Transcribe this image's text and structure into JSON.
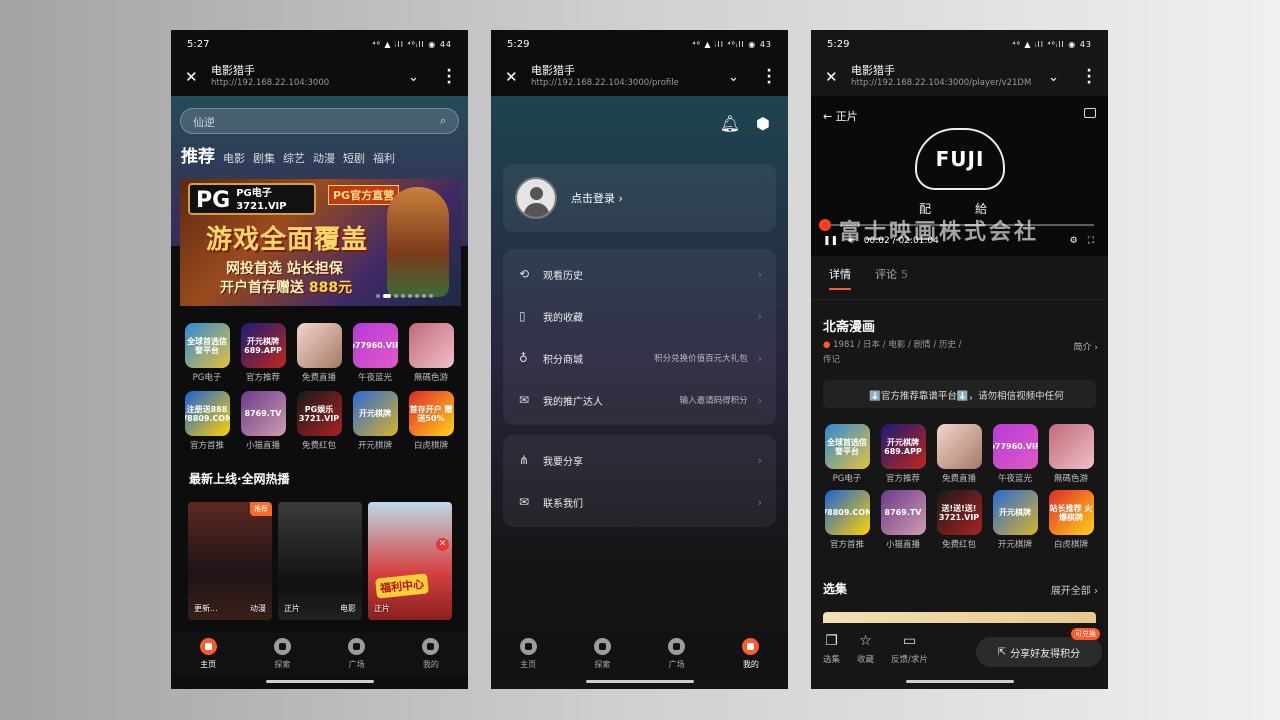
{
  "app": {
    "name": "电影猎手"
  },
  "phones": [
    {
      "time": "5:27",
      "status": "⁴⁶ ▲ ᵢll ⁴⁶ᵢll ◉ 44",
      "url": "http://192.168.22.104:3000",
      "search": {
        "placeholder": "仙逆"
      },
      "categories": [
        "推荐",
        "电影",
        "剧集",
        "综艺",
        "动漫",
        "短剧",
        "福利"
      ],
      "banner": {
        "brand": "PG",
        "brand_sub": "PG电子",
        "brand_url": "3721.VIP",
        "official": "PG官方直营",
        "headline": "游戏全面覆盖",
        "line1": "网投首选 站长担保",
        "line2": "开户首存赠送",
        "amount": "888元"
      },
      "apps": [
        {
          "name": "PG电子",
          "icon": "全球首选信誉平台"
        },
        {
          "name": "官方推荐",
          "icon": "开元棋牌 689.APP"
        },
        {
          "name": "免费直播",
          "icon": ""
        },
        {
          "name": "午夜蓝光",
          "icon": "b77960.VIP"
        },
        {
          "name": "無碼色游",
          "icon": ""
        },
        {
          "name": "官方首推",
          "icon": "注册送888 V8809.COM"
        },
        {
          "name": "小猫直播",
          "icon": "8769.TV"
        },
        {
          "name": "免费红包",
          "icon": "PG娱乐 3721.VIP"
        },
        {
          "name": "开元棋牌",
          "icon": "开元棋牌"
        },
        {
          "name": "白虎棋牌",
          "icon": "首存开户 赠送50%"
        }
      ],
      "section_title": "最新上线·全网热播",
      "posters": [
        {
          "tag": "推荐",
          "left": "更新...",
          "right": "动漫"
        },
        {
          "tag": "",
          "left": "正片",
          "right": "电影"
        },
        {
          "tag": "",
          "left": "正片",
          "right": "",
          "overlay": "福利中心"
        }
      ],
      "nav": [
        "主页",
        "探索",
        "广场",
        "我的"
      ]
    },
    {
      "time": "5:29",
      "status": "⁴⁶ ▲ ᵢll ⁴⁶ᵢll ◉ 43",
      "url": "http://192.168.22.104:3000/profile",
      "login": "点击登录 ›",
      "menu1": [
        {
          "icon": "⟲",
          "label": "观看历史",
          "right": ""
        },
        {
          "icon": "▯",
          "label": "我的收藏",
          "right": ""
        },
        {
          "icon": "♁",
          "label": "积分商城",
          "right": "积分兑换价值百元大礼包"
        },
        {
          "icon": "✉",
          "label": "我的推广达人",
          "right": "输入邀请码得积分"
        }
      ],
      "menu2": [
        {
          "icon": "⋔",
          "label": "我要分享",
          "right": ""
        },
        {
          "icon": "✉",
          "label": "联系我们",
          "right": ""
        }
      ],
      "nav": [
        "主页",
        "探索",
        "广场",
        "我的"
      ]
    },
    {
      "time": "5:29",
      "status": "⁴⁶ ▲ ᵢll ⁴⁶ᵢll ◉ 43",
      "url": "http://192.168.22.104:3000/player/v21DM",
      "player": {
        "back": "← 正片",
        "logo": "FUJI",
        "sub": "配給",
        "company": "富士映画株式会社",
        "time": "00:02 / 02:01:04",
        "progress": 0.0002
      },
      "tabs": {
        "details": "详情",
        "comments": "评论",
        "comment_count": "5"
      },
      "title": "北斋漫画",
      "intro": "简介 ›",
      "info": [
        "1981",
        "日本",
        "电影",
        "剧情",
        "历史",
        "传记"
      ],
      "notice": "⬇️官方推荐靠谱平台⬇️，请勿相信视频中任何",
      "apps": [
        {
          "name": "PG电子",
          "icon": "全球首选信誉平台"
        },
        {
          "name": "官方推荐",
          "icon": "开元棋牌 689.APP"
        },
        {
          "name": "免费直播",
          "icon": ""
        },
        {
          "name": "午夜蓝光",
          "icon": "b77960.VIP"
        },
        {
          "name": "無碼色游",
          "icon": ""
        },
        {
          "name": "官方首推",
          "icon": "V8809.COM"
        },
        {
          "name": "小猫直播",
          "icon": "8769.TV"
        },
        {
          "name": "免费红包",
          "icon": "送!送!送! 3721.VIP"
        },
        {
          "name": "开元棋牌",
          "icon": "开元棋牌"
        },
        {
          "name": "白虎棋牌",
          "icon": "站长推荐 火爆棋牌"
        }
      ],
      "episodes": "选集",
      "expand": "展开全部 ›",
      "bottom": [
        "选集",
        "收藏",
        "反馈/求片"
      ],
      "share": "分享好友得积分",
      "badge": "可兑换"
    }
  ]
}
